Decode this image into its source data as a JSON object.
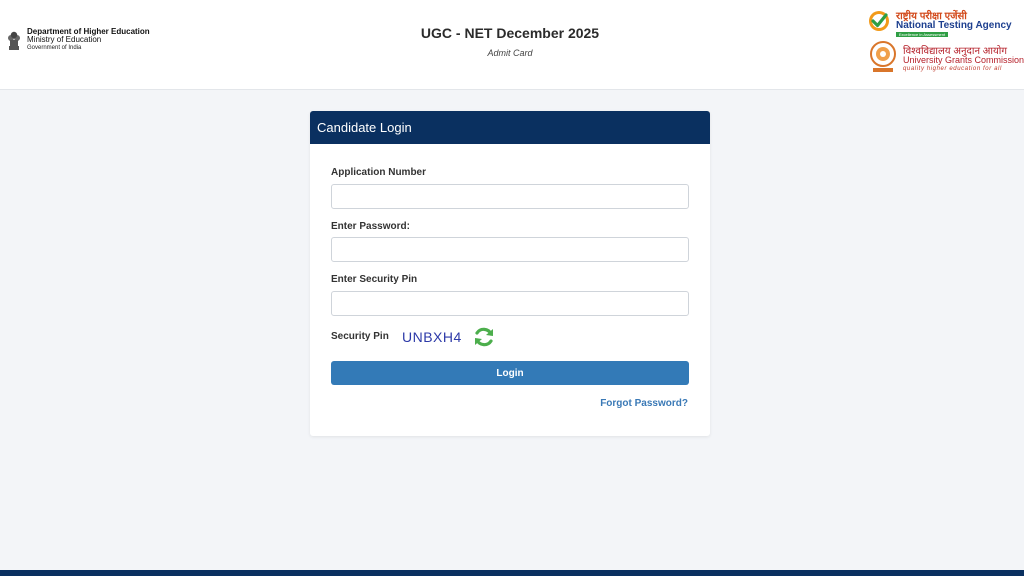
{
  "header": {
    "dept": {
      "line1": "Department of Higher Education",
      "line2": "Ministry of Education",
      "line3": "Government of India",
      "emblem_icon": "national-emblem-icon"
    },
    "title": "UGC - NET December 2025",
    "subtitle": "Admit Card",
    "nta": {
      "hindi": "राष्ट्रीय परीक्षा एजेंसी",
      "english": "National Testing Agency",
      "tagline": "Excellence in Assessment",
      "icon": "nta-checkmark-logo"
    },
    "ugc": {
      "hindi": "विश्वविद्यालय अनुदान आयोग",
      "english": "University Grants Commission",
      "tagline": "quality higher education for all",
      "icon": "ugc-seal-logo"
    }
  },
  "login": {
    "heading": "Candidate Login",
    "application_number_label": "Application Number",
    "application_number_value": "",
    "password_label": "Enter Password:",
    "password_value": "",
    "security_pin_label": "Enter Security Pin",
    "security_pin_value": "",
    "captcha_label": "Security Pin",
    "captcha_code": "UNBXH4",
    "refresh_icon": "refresh-icon",
    "login_button": "Login",
    "forgot_password": "Forgot Password?"
  },
  "colors": {
    "header_bar": "#0a3060",
    "button": "#337ab7",
    "link": "#3a79b6",
    "captcha_text": "#2d3aa8",
    "page_bg": "#f3f5f8"
  }
}
